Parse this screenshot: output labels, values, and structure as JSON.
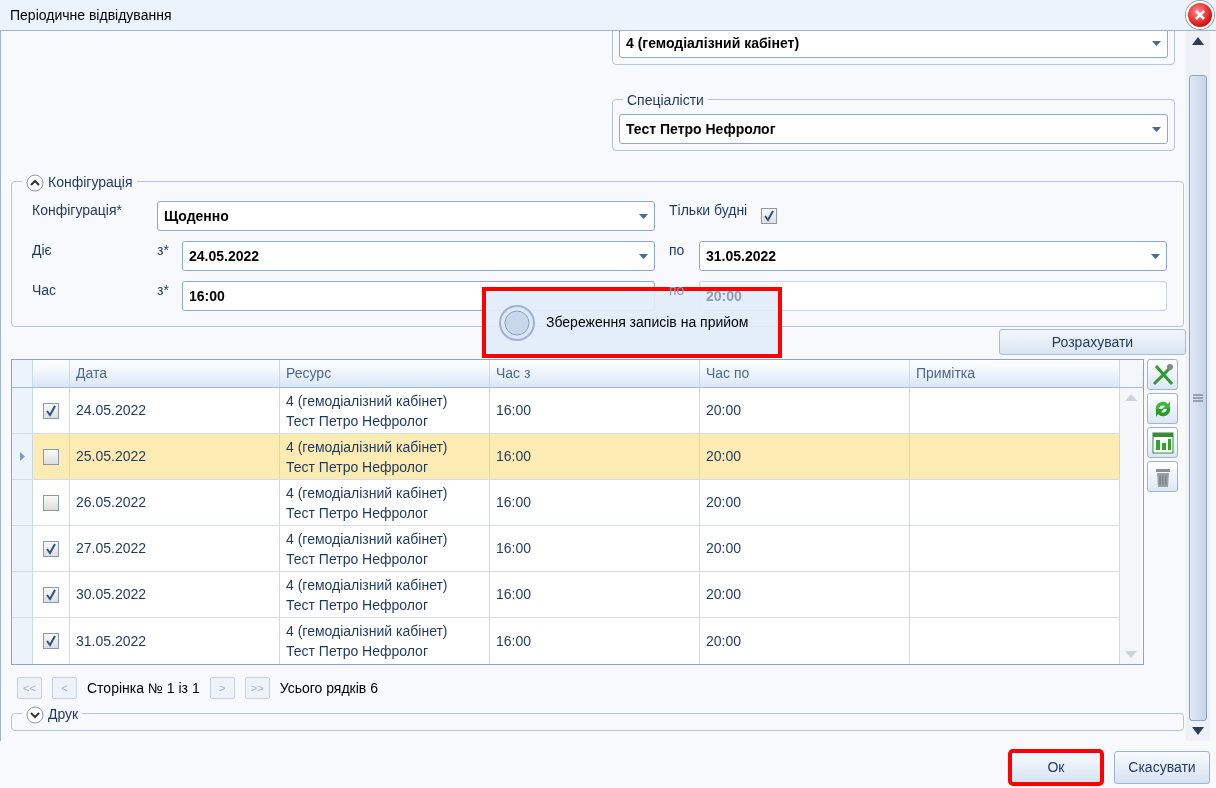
{
  "window": {
    "title": "Періодичне відвідування"
  },
  "resource_group": {
    "value": "4 (гемодіалізний кабінет)"
  },
  "specialists_group": {
    "legend": "Спеціалісти",
    "value": "Тест Петро Нефролог"
  },
  "configuration": {
    "legend": "Конфігурація",
    "expanded": true,
    "config_label": "Конфігурація*",
    "config_value": "Щоденно",
    "weekdays_label": "Тільки будні",
    "weekdays_checked": true,
    "valid_label": "Діє",
    "valid_from_label": "з*",
    "valid_from": "24.05.2022",
    "valid_to_label": "по",
    "valid_to": "31.05.2022",
    "time_label": "Час",
    "time_from_label": "з*",
    "time_from": "16:00",
    "time_to_label": "по",
    "time_to": "20:00"
  },
  "loading": {
    "text": "Збереження записів на прийом",
    "highlighted": true
  },
  "calculate_button": "Розрахувати",
  "table": {
    "columns": [
      "Дата",
      "Ресурс",
      "Час з",
      "Час по",
      "Примітка"
    ],
    "rows": [
      {
        "checked": true,
        "selected": false,
        "date": "24.05.2022",
        "resource": [
          "4 (гемодіалізний кабінет)",
          "Тест Петро Нефролог"
        ],
        "from": "16:00",
        "to": "20:00"
      },
      {
        "checked": false,
        "selected": true,
        "date": "25.05.2022",
        "resource": [
          "4 (гемодіалізний кабінет)",
          "Тест Петро Нефролог"
        ],
        "from": "16:00",
        "to": "20:00"
      },
      {
        "checked": false,
        "selected": false,
        "date": "26.05.2022",
        "resource": [
          "4 (гемодіалізний кабінет)",
          "Тест Петро Нефролог"
        ],
        "from": "16:00",
        "to": "20:00"
      },
      {
        "checked": true,
        "selected": false,
        "date": "27.05.2022",
        "resource": [
          "4 (гемодіалізний кабінет)",
          "Тест Петро Нефролог"
        ],
        "from": "16:00",
        "to": "20:00"
      },
      {
        "checked": true,
        "selected": false,
        "date": "30.05.2022",
        "resource": [
          "4 (гемодіалізний кабінет)",
          "Тест Петро Нефролог"
        ],
        "from": "16:00",
        "to": "20:00"
      },
      {
        "checked": true,
        "selected": false,
        "date": "31.05.2022",
        "resource": [
          "4 (гемодіалізний кабінет)",
          "Тест Петро Нефролог"
        ],
        "from": "16:00",
        "to": "20:00"
      }
    ]
  },
  "pager": {
    "first": "<<",
    "prev": "<",
    "page_text": "Сторінка № 1 із 1",
    "next": ">",
    "last": ">>",
    "total_text": "Усього рядків 6",
    "disabled": true
  },
  "print_group": {
    "legend": "Друк",
    "expanded": false
  },
  "buttons": [
    {
      "label": "Ок",
      "highlighted": true
    },
    {
      "label": "Скасувати",
      "highlighted": false
    }
  ]
}
